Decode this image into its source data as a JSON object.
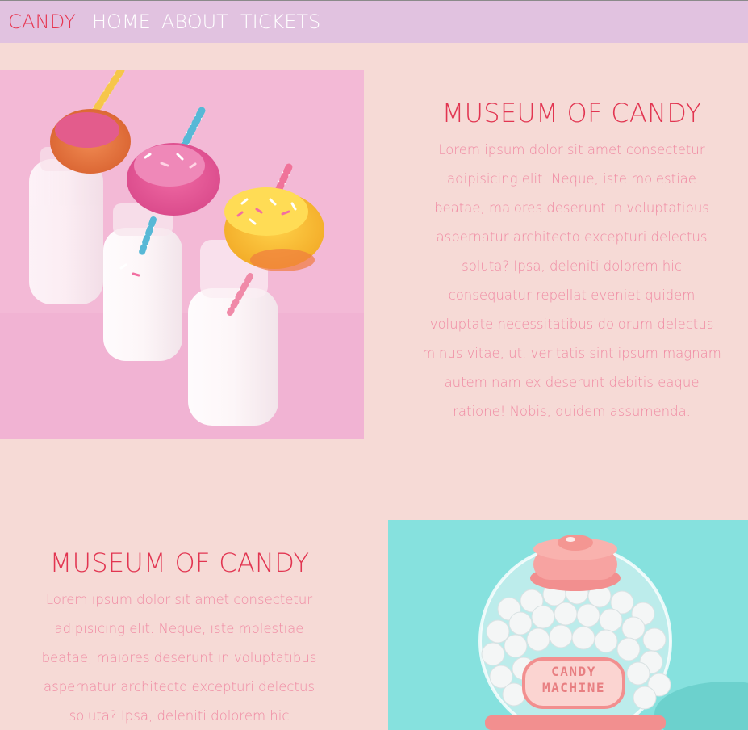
{
  "nav": {
    "brand": "CANDY",
    "links": [
      "HOME",
      "ABOUT",
      "TICKETS"
    ]
  },
  "sections": [
    {
      "title": "MUSEUM OF CANDY",
      "text": "Lorem ipsum dolor sit amet consectetur adipisicing elit. Neque, iste molestiae beatae, maiores deserunt in voluptatibus aspernatur architecto excepturi delectus soluta? Ipsa, deleniti dolorem hic consequatur repellat eveniet quidem voluptate necessitatibus dolorum delectus minus vitae, ut, veritatis sint ipsum magnam autem nam ex deserunt debitis eaque ratione! Nobis, quidem assumenda.",
      "image": "donuts-on-milk-bottles"
    },
    {
      "title": "MUSEUM OF CANDY",
      "text": "Lorem ipsum dolor sit amet consectetur adipisicing elit. Neque, iste molestiae beatae, maiores deserunt in voluptatibus aspernatur architecto excepturi delectus soluta? Ipsa, deleniti dolorem hic consequatur repellat",
      "image": "candy-machine",
      "image_label_line1": "CANDY",
      "image_label_line2": "MACHINE"
    }
  ],
  "colors": {
    "nav_bg": "#e1c2e0",
    "page_bg": "#f6dad6",
    "brand": "#e7344f",
    "title": "#e23551",
    "text": "#f08aa3"
  }
}
